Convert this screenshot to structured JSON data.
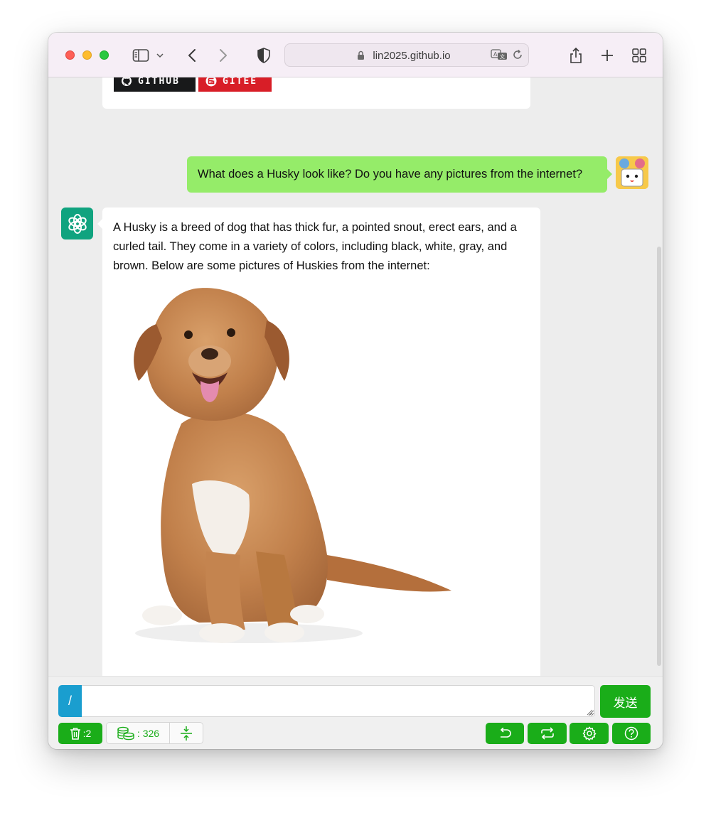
{
  "browser": {
    "url": "lin2025.github.io",
    "icons": [
      "sidebar-icon",
      "chevron-down-icon",
      "back-icon",
      "forward-icon",
      "shield-icon",
      "lock-icon",
      "translate-icon",
      "reload-icon",
      "share-icon",
      "new-tab-icon",
      "tab-overview-icon"
    ]
  },
  "previous_message": {
    "badges": [
      {
        "label": "GITHUB",
        "icon": "github-icon",
        "color": "#18191a"
      },
      {
        "label": "GITEE",
        "icon": "gitee-icon",
        "color": "#d81e27"
      }
    ]
  },
  "conversation": {
    "user_message": "What does a Husky look like? Do you have any pictures from the internet?",
    "assistant_message": "A Husky is a breed of dog that has thick fur, a pointed snout, erect ears, and a curled tail. They come in a variety of colors, including black, white, gray, and brown. Below are some pictures of Huskies from the internet:",
    "broken_image_glyph": "?"
  },
  "input_bar": {
    "command_label": "/",
    "input_value": "",
    "send_label": "发送"
  },
  "footer": {
    "clear_count": ":2",
    "token_count": ": 326",
    "buttons": [
      "undo-icon",
      "regenerate-icon",
      "settings-icon",
      "help-icon"
    ]
  },
  "colors": {
    "accent_green": "#1aad19",
    "user_bubble": "#95ec69",
    "assistant_avatar": "#10a37f",
    "command_blue": "#1a9ecf"
  }
}
